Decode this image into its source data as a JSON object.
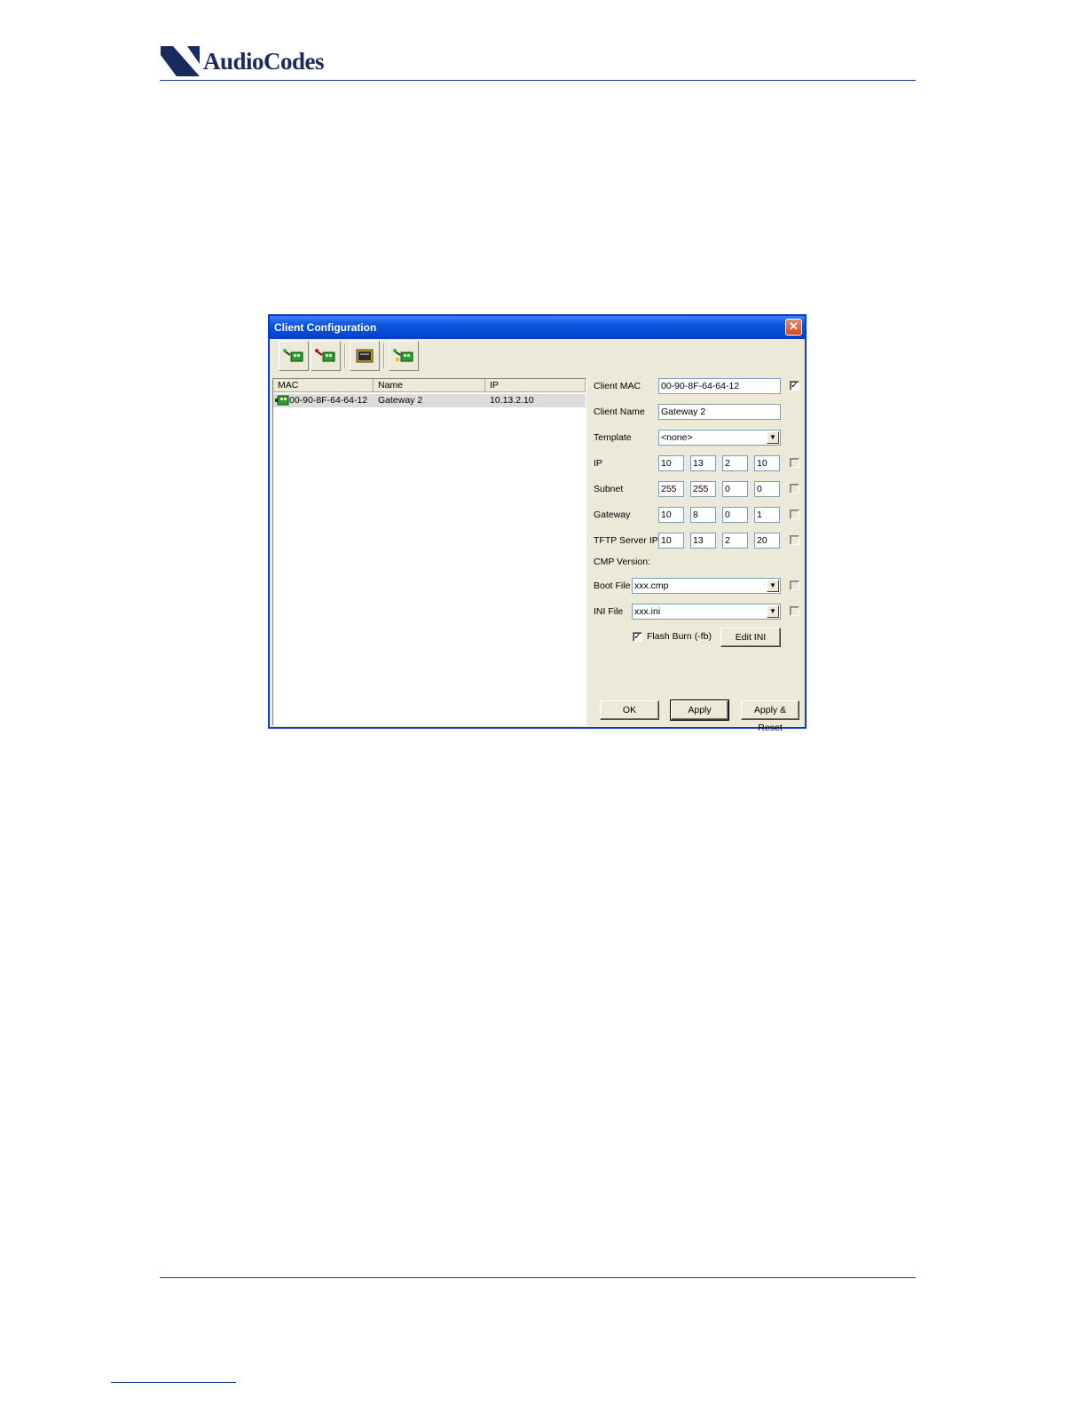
{
  "page": {
    "logo_text": "AudioCodes"
  },
  "dialog": {
    "title": "Client Configuration",
    "close_glyph": "✕",
    "toolbar": {
      "buttons": [
        {
          "icon": "add-client-icon"
        },
        {
          "icon": "remove-client-icon"
        },
        {
          "icon": "template-icon"
        },
        {
          "icon": "client-settings-icon"
        }
      ]
    },
    "list": {
      "columns": [
        "MAC",
        "Name",
        "IP"
      ],
      "rows": [
        {
          "mac": "00-90-8F-64-64-12",
          "name": "Gateway 2",
          "ip": "10.13.2.10"
        }
      ]
    },
    "form": {
      "client_mac_label": "Client MAC",
      "client_mac_value": "00-90-8F-64-64-12",
      "client_mac_checked": "✓",
      "client_name_label": "Client Name",
      "client_name_value": "Gateway 2",
      "template_label": "Template",
      "template_value": "<none>",
      "ip_label": "IP",
      "ip": [
        "10",
        "13",
        "2",
        "10"
      ],
      "subnet_label": "Subnet",
      "subnet": [
        "255",
        "255",
        "0",
        "0"
      ],
      "gateway_label": "Gateway",
      "gateway": [
        "10",
        "8",
        "0",
        "1"
      ],
      "tftp_label": "TFTP Server IP",
      "tftp": [
        "10",
        "13",
        "2",
        "20"
      ],
      "cmp_version_label": "CMP Version:",
      "boot_file_label": "Boot File",
      "boot_file_value": "xxx.cmp",
      "ini_file_label": "INI File",
      "ini_file_value": "xxx.ini",
      "flash_burn_label": "Flash Burn (-fb)",
      "flash_burn_checked": "✓",
      "edit_ini_label": "Edit INI"
    },
    "buttons": {
      "ok": "OK",
      "apply": "Apply",
      "apply_reset": "Apply & Reset"
    }
  }
}
